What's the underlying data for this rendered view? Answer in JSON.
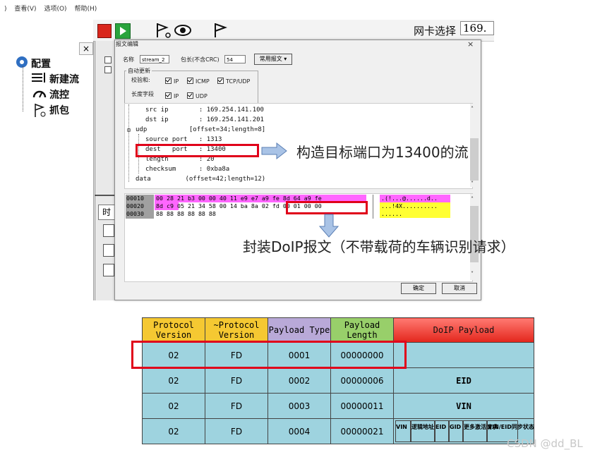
{
  "menu": [
    "查看(V)",
    "选项(O)",
    "帮助(H)"
  ],
  "toolbar": {
    "nic_label": "网卡选择",
    "nic_value": "169."
  },
  "left_panel": {
    "close": "×",
    "items": [
      "配置",
      "新建流",
      "流控",
      "抓包"
    ]
  },
  "mid_panel": {
    "tab": "时"
  },
  "dialog": {
    "title": "报文编辑",
    "close": "×",
    "name_label": "名称",
    "name_value": "stream_2",
    "length_label": "包长(不含CRC)",
    "length_value": "54",
    "common_btn": "常用报文",
    "auto_update": "自动更新",
    "checksum_label": "校验和:",
    "checksum_opts": [
      "IP",
      "ICMP",
      "TCP/UDP"
    ],
    "lenfield_label": "长度字段",
    "lenfield_opts": [
      "IP",
      "UDP"
    ],
    "tree": [
      "src ip        : 169.254.141.100",
      "dst ip        : 169.254.141.201",
      "udp           [offset=34;length=8]",
      "source port   : 1313",
      "dest   port   : 13400",
      "length        : 20",
      "checksum      : 0xba8a",
      "data         (offset=42;length=12)"
    ],
    "hex_rows": [
      {
        "off": "00010",
        "bytes": "00 28 21 b3 00 00 40 11 e9 e7 a9 fe 8d 64 a9 fe",
        "ascii": ".(!...@......d.."
      },
      {
        "off": "00020",
        "bytes": "8d c9 05 21 34 58 00 14 ba 8a 02 fd 00 01 00 00",
        "ascii": "...!4X.........."
      },
      {
        "off": "00030",
        "bytes": "88 88 88 88 88 88",
        "ascii": "......"
      }
    ],
    "ok": "确定",
    "cancel": "取消"
  },
  "annotations": {
    "port": "构造目标端口为13400的流",
    "doip": "封装DoIP报文（不带载荷的车辆识别请求）"
  },
  "doip_table": {
    "headers": [
      "Protocol Version",
      "~Protocol Version",
      "Payload Type",
      "Payload Length",
      "DoIP Payload"
    ],
    "rows": [
      [
        "02",
        "FD",
        "0001",
        "00000000",
        ""
      ],
      [
        "02",
        "FD",
        "0002",
        "00000006",
        "EID"
      ],
      [
        "02",
        "FD",
        "0003",
        "00000011",
        "VIN"
      ],
      [
        "02",
        "FD",
        "0004",
        "00000021",
        ""
      ]
    ],
    "last_row_sub": [
      "VIN",
      "逻辑地址",
      "EID",
      "GID",
      "更多激活请求",
      "VIN/EID同步状态"
    ]
  },
  "colors": {
    "header_yellow": "#f5c832",
    "header_purple": "#b9a9d8",
    "header_green": "#98cf6a",
    "header_red": "#e3261c",
    "cell_blue": "#9ed3df",
    "highlight_red": "#e0001a",
    "hex_magenta": "#ff66ff",
    "hex_yellow": "#ffff33"
  },
  "watermark": "CSDN @dd_BL"
}
